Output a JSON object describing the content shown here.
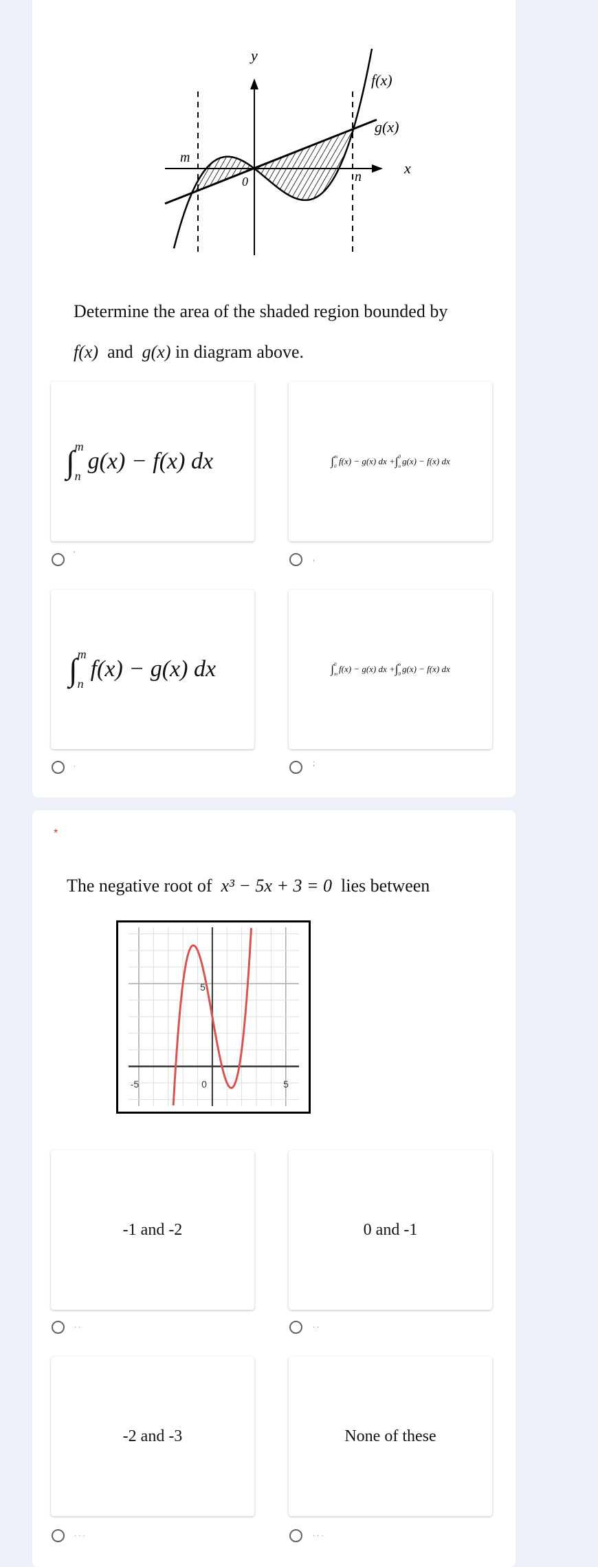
{
  "question1": {
    "diagram": {
      "y_label": "y",
      "x_label": "x",
      "f_label": "f(x)",
      "g_label": "g(x)",
      "m_label": "m",
      "n_label": "n",
      "origin_label": "0"
    },
    "text_line1": "Determine the area of the shaded region bounded by",
    "text_line2_f": "f(x)",
    "text_line2_and": "and",
    "text_line2_g": "g(x)",
    "text_line2_rest": "in diagram above.",
    "options": [
      {
        "upper": "m",
        "lower": "n",
        "integrand": "g(x) − f(x) dx",
        "radio_label": "'"
      },
      {
        "part1_upper": "m",
        "part1_lower": "0",
        "part1": "f(x) − g(x) dx +",
        "part2_upper": "0",
        "part2_lower": "n",
        "part2": "g(x) − f(x) dx",
        "radio_label": ","
      },
      {
        "upper": "m",
        "lower": "n",
        "integrand": "f(x) − g(x) dx",
        "radio_label": "."
      },
      {
        "part1_upper": "0",
        "part1_lower": "m",
        "part1": "f(x) − g(x) dx +",
        "part2_upper": "n",
        "part2_lower": "0",
        "part2": "g(x) − f(x) dx",
        "radio_label": ";"
      }
    ]
  },
  "question2": {
    "required_mark": "*",
    "text_before": "The negative root of",
    "equation": "x³ − 5x + 3 = 0",
    "text_after": "lies between",
    "colors": {
      "curve": "#d9534f",
      "required": "#d93025"
    },
    "chart_data": {
      "type": "line",
      "function": "x^3 - 5x + 3",
      "xlim": [
        -5.7,
        5.9
      ],
      "ylim": [
        -2.4,
        8.4
      ],
      "grid": true,
      "x_ticks": [
        "-5",
        "0",
        "5"
      ],
      "y_ticks": [
        "5"
      ]
    },
    "options": [
      {
        "label": "-1 and -2",
        "radio_label": ". ."
      },
      {
        "label": "0 and -1",
        "radio_label": ". ."
      },
      {
        "label": "-2 and -3",
        "radio_label": ". . ."
      },
      {
        "label": "None of these",
        "radio_label": ". . ."
      }
    ]
  }
}
